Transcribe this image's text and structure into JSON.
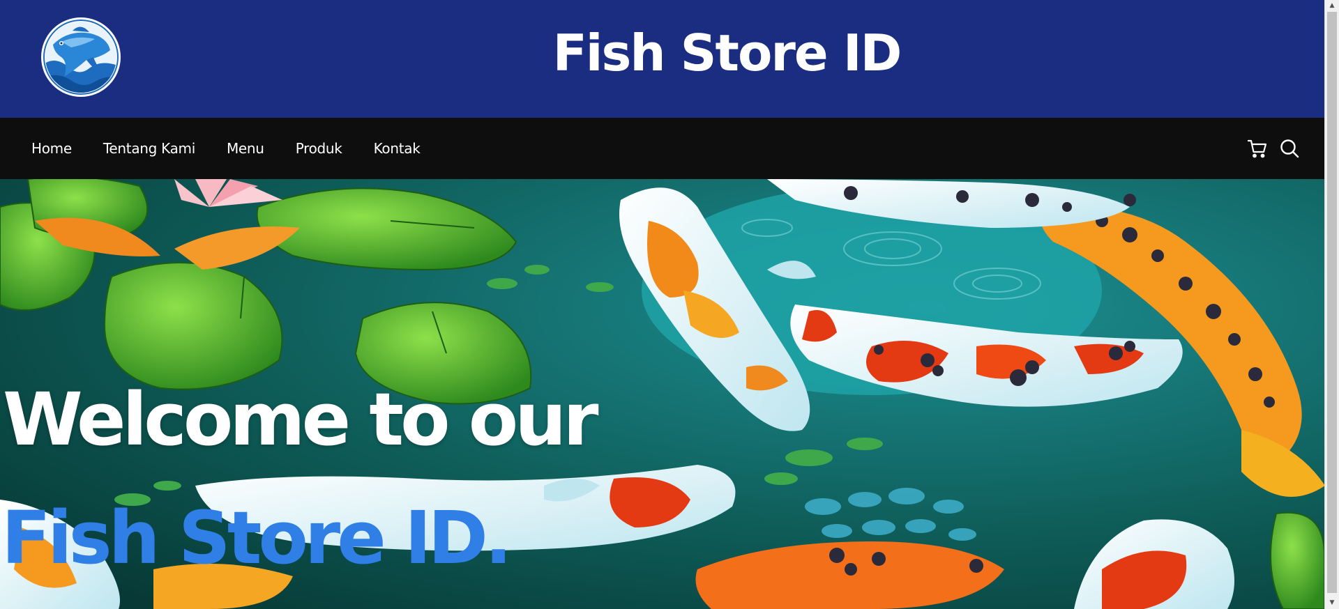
{
  "header": {
    "logo_icon": "fish-logo-icon",
    "title": "Fish Store ID",
    "background_color": "#1a2d80"
  },
  "nav": {
    "background_color": "#0e0e0e",
    "links": [
      {
        "label": "Home"
      },
      {
        "label": "Tentang Kami"
      },
      {
        "label": "Menu"
      },
      {
        "label": "Produk"
      },
      {
        "label": "Kontak"
      }
    ],
    "icons": [
      "cart-icon",
      "search-icon"
    ]
  },
  "hero": {
    "line1": "Welcome to our",
    "line2": "Fish Store ID.",
    "line1_color": "#ffffff",
    "line2_color": "#2f7fe6",
    "background_description": "koi-pond-image"
  }
}
